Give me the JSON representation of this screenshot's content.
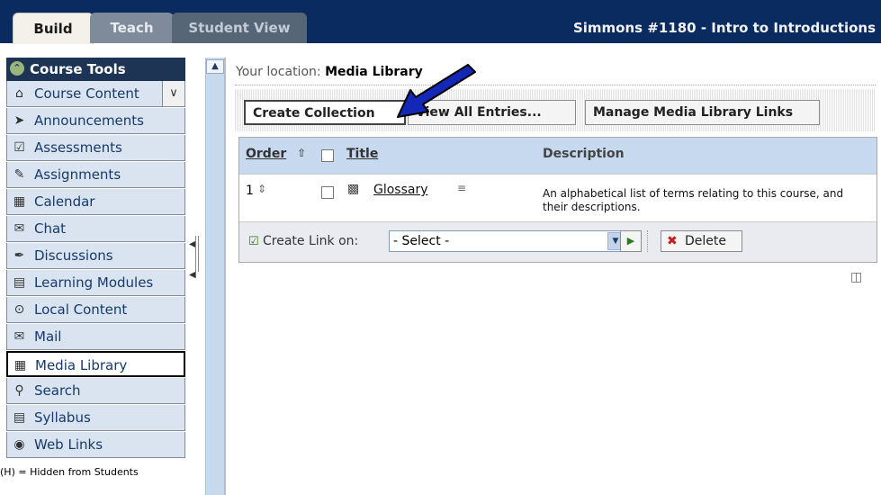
{
  "tabs": [
    {
      "label": "Build"
    },
    {
      "label": "Teach"
    },
    {
      "label": "Student View"
    }
  ],
  "course_title": "Simmons #1180 - Intro to Introductions",
  "sidebar": {
    "header": "Course Tools",
    "items": [
      {
        "label": "Course Content",
        "icon": "home-icon"
      },
      {
        "label": "Announcements",
        "icon": "megaphone-icon"
      },
      {
        "label": "Assessments",
        "icon": "assessment-icon"
      },
      {
        "label": "Assignments",
        "icon": "assignment-icon"
      },
      {
        "label": "Calendar",
        "icon": "calendar-icon"
      },
      {
        "label": "Chat",
        "icon": "chat-icon"
      },
      {
        "label": "Discussions",
        "icon": "discussions-icon"
      },
      {
        "label": "Learning Modules",
        "icon": "module-icon"
      },
      {
        "label": "Local Content",
        "icon": "local-content-icon"
      },
      {
        "label": "Mail",
        "icon": "mail-icon"
      },
      {
        "label": "Media Library",
        "icon": "media-library-icon"
      },
      {
        "label": "Search",
        "icon": "search-icon"
      },
      {
        "label": "Syllabus",
        "icon": "syllabus-icon"
      },
      {
        "label": "Web Links",
        "icon": "web-links-icon"
      }
    ],
    "note": "(H) = Hidden from Students"
  },
  "location": {
    "prefix": "Your location:",
    "page": "Media Library"
  },
  "buttons": {
    "create": "Create Collection",
    "view_all": "View All Entries...",
    "manage": "Manage Media Library Links"
  },
  "table": {
    "headers": {
      "order": "Order",
      "title": "Title",
      "description": "Description"
    },
    "rows": [
      {
        "order": "1",
        "title": "Glossary",
        "description": "An alphabetical list of terms relating to this course, and their descriptions."
      }
    ]
  },
  "footer": {
    "create_link_label": "Create Link on:",
    "select_value": "- Select -",
    "delete_label": "Delete"
  }
}
